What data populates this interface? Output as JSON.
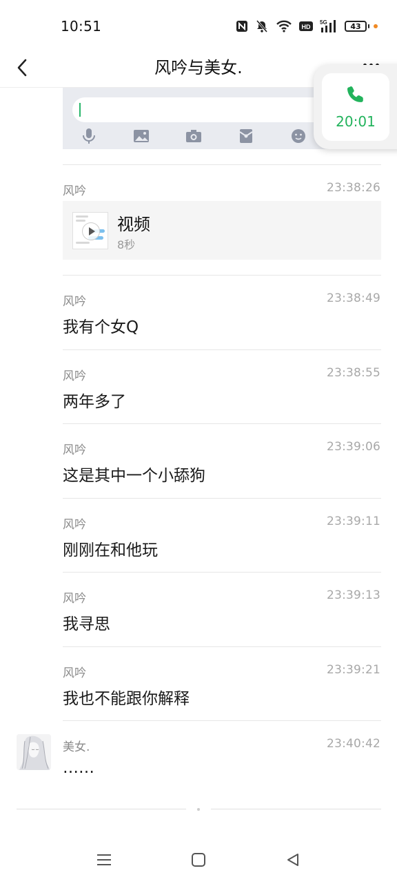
{
  "status_bar": {
    "time": "10:51",
    "battery_level": "43",
    "network": "5G",
    "hd_label": "HD",
    "icons": [
      "nfc-icon",
      "bell-off-icon",
      "wifi-icon",
      "hd-icon",
      "signal-5g-icon",
      "battery-icon",
      "charging-dot-icon"
    ],
    "charging_color": "#f08a24"
  },
  "header": {
    "title": "风吟与美女.",
    "back_icon": "chevron-left-icon",
    "more_icon": "more-dots-icon"
  },
  "input_preview": {
    "tools": [
      "microphone-icon",
      "image-icon",
      "camera-icon",
      "red-packet-icon",
      "emoji-icon"
    ],
    "cursor_color": "#28b66a"
  },
  "call_float": {
    "duration": "20:01",
    "icon": "phone-icon",
    "accent": "#22b35c"
  },
  "messages": [
    {
      "sender": "风吟",
      "time": "23:38:26",
      "type": "video",
      "video_title": "视频",
      "video_duration": "8秒"
    },
    {
      "sender": "风吟",
      "time": "23:38:49",
      "type": "text",
      "text": "我有个女Q"
    },
    {
      "sender": "风吟",
      "time": "23:38:55",
      "type": "text",
      "text": "两年多了"
    },
    {
      "sender": "风吟",
      "time": "23:39:06",
      "type": "text",
      "text": "这是其中一个小舔狗"
    },
    {
      "sender": "风吟",
      "time": "23:39:11",
      "type": "text",
      "text": "刚刚在和他玩"
    },
    {
      "sender": "风吟",
      "time": "23:39:13",
      "type": "text",
      "text": "我寻思"
    },
    {
      "sender": "风吟",
      "time": "23:39:21",
      "type": "text",
      "text": "我也不能跟你解释"
    },
    {
      "sender": "美女.",
      "time": "23:40:42",
      "type": "text",
      "text": "……",
      "has_avatar": true
    }
  ],
  "system_nav": {
    "icons": [
      "menu-icon",
      "home-square-icon",
      "back-triangle-icon"
    ]
  }
}
